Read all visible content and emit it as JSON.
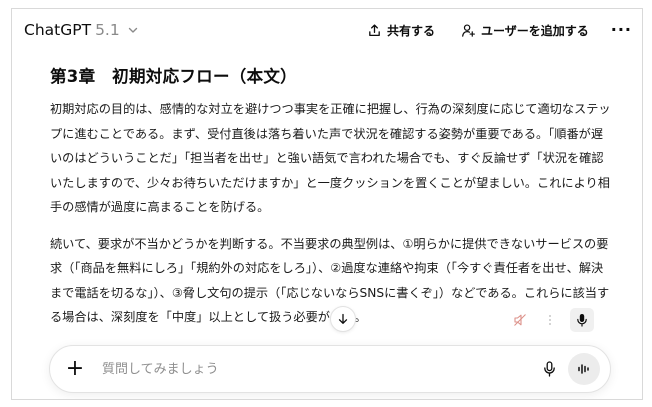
{
  "header": {
    "model_name": "ChatGPT",
    "model_version": "5.1",
    "share_label": "共有する",
    "add_user_label": "ユーザーを追加する",
    "more_label": "···"
  },
  "document": {
    "heading": "第3章　初期対応フロー（本文）",
    "paragraphs": [
      "初期対応の目的は、感情的な対立を避けつつ事実を正確に把握し、行為の深刻度に応じて適切なステップに進むことである。まず、受付直後は落ち着いた声で状況を確認する姿勢が重要である。「順番が遅いのはどういうことだ」「担当者を出せ」と強い語気で言われた場合でも、すぐ反論せず「状況を確認いたしますので、少々お待ちいただけますか」と一度クッションを置くことが望ましい。これにより相手の感情が過度に高まることを防げる。",
      "続いて、要求が不当かどうかを判断する。不当要求の典型例は、①明らかに提供できないサービスの要求（「商品を無料にしろ」「規約外の対応をしろ」）、②過度な連絡や拘束（「今すぐ責任者を出せ、解決まで電話を切るな」）、③脅し文句の提示（「応じないならSNSに書くぞ」）などである。これらに該当する場合は、深刻度を「中度」以上として扱う必要がある。"
    ]
  },
  "composer": {
    "placeholder": "質問してみましょう"
  },
  "icons": {
    "share": "share-upload-icon",
    "add_user": "add-person-icon",
    "scroll_down": "arrow-down-icon",
    "mute": "speaker-muted-icon",
    "tool_more": "vertical-dots-icon",
    "mic": "microphone-icon",
    "voice": "voice-waveform-icon",
    "plus": "plus-icon"
  }
}
